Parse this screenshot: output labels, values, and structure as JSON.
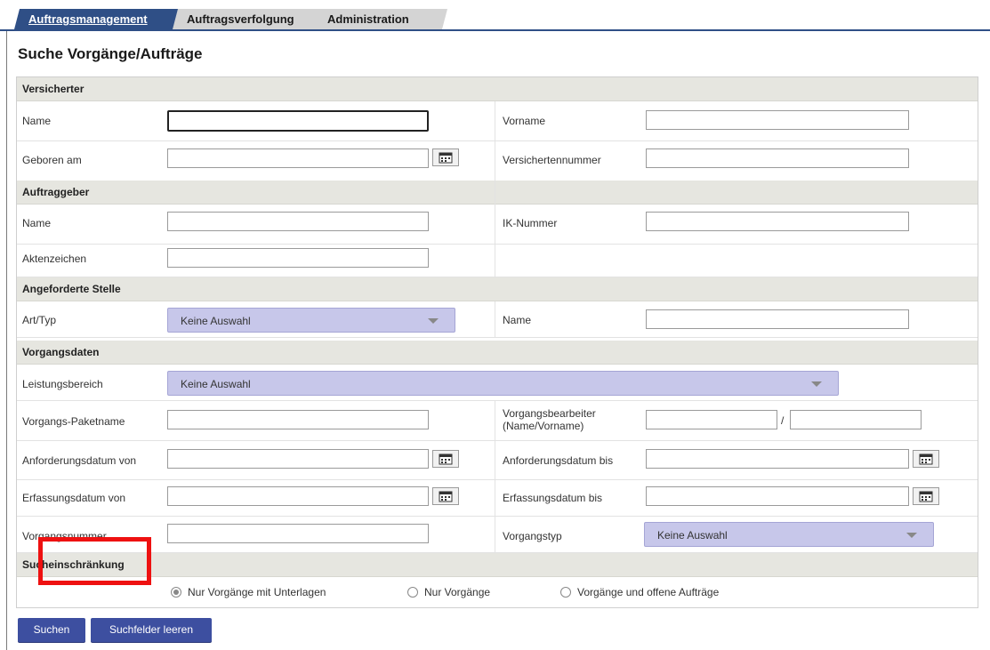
{
  "tabs": [
    {
      "label": "Auftragsmanagement",
      "active": true
    },
    {
      "label": "Auftragsverfolgung",
      "active": false
    },
    {
      "label": "Administration",
      "active": false
    }
  ],
  "page_title": "Suche Vorgänge/Aufträge",
  "sections": {
    "versicherter": {
      "header": "Versicherter",
      "name": "Name",
      "vorname": "Vorname",
      "geboren_am": "Geboren am",
      "versichertennummer": "Versichertennummer"
    },
    "auftraggeber": {
      "header": "Auftraggeber",
      "name": "Name",
      "ik_nummer": "IK-Nummer",
      "aktenzeichen": "Aktenzeichen"
    },
    "angeforderte_stelle": {
      "header": "Angeforderte Stelle",
      "art_typ": "Art/Typ",
      "art_typ_value": "Keine Auswahl",
      "name": "Name"
    },
    "vorgangsdaten": {
      "header": "Vorgangsdaten",
      "leistungsbereich": "Leistungsbereich",
      "leistungsbereich_value": "Keine Auswahl",
      "paketname": "Vorgangs-Paketname",
      "bearbeiter_line1": "Vorgangsbearbeiter",
      "bearbeiter_line2": "(Name/Vorname)",
      "separator": "/",
      "anforderungsdatum_von": "Anforderungsdatum von",
      "anforderungsdatum_bis": "Anforderungsdatum bis",
      "erfassungsdatum_von": "Erfassungsdatum von",
      "erfassungsdatum_bis": "Erfassungsdatum bis",
      "vorgangsnummer": "Vorgangsnummer",
      "vorgangstyp": "Vorgangstyp",
      "vorgangstyp_value": "Keine Auswahl"
    },
    "sucheinschraenkung": {
      "header": "Sucheinschränkung",
      "options": [
        "Nur Vorgänge mit Unterlagen",
        "Nur Vorgänge",
        "Vorgänge und offene Aufträge"
      ],
      "selected_index": 0
    }
  },
  "buttons": {
    "search": "Suchen",
    "clear": "Suchfelder leeren"
  },
  "colors": {
    "tab_active": "#2f4f86",
    "dropdown": "#c7c7ea",
    "button": "#3d4fa0",
    "highlight": "#ee1111"
  }
}
